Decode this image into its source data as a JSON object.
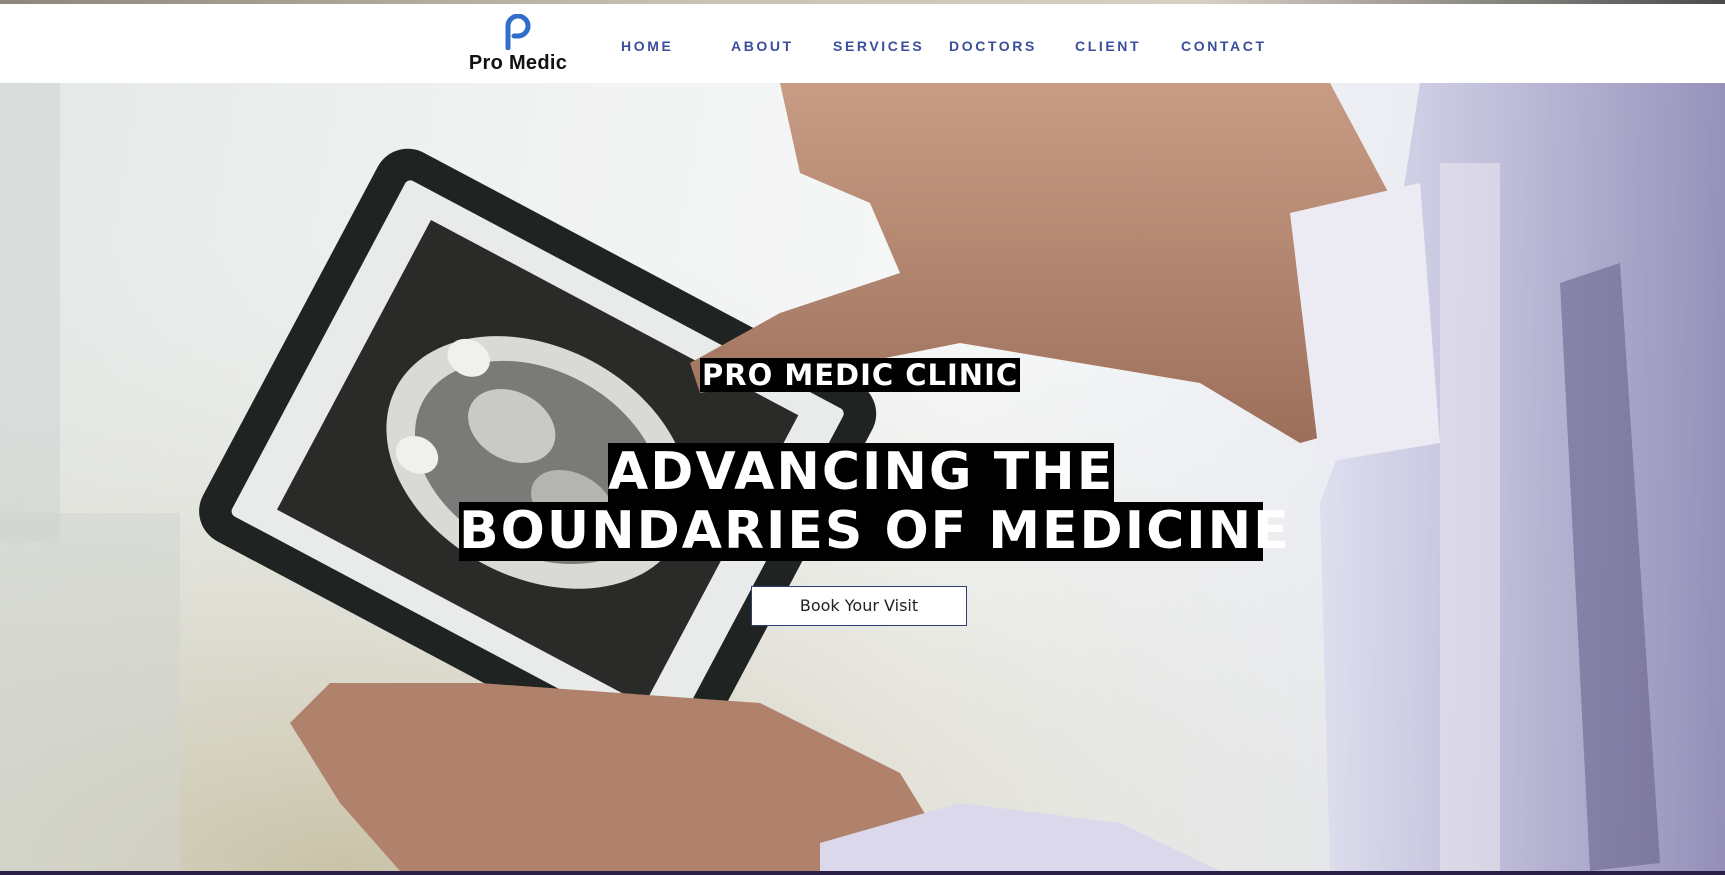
{
  "brand": {
    "name": "Pro Medic",
    "logo_icon": "p-letter-logo-icon",
    "accent_color": "#3a4e9c"
  },
  "nav": {
    "items": [
      {
        "label": "HOME"
      },
      {
        "label": "ABOUT"
      },
      {
        "label": "SERVICES"
      },
      {
        "label": "DOCTORS"
      },
      {
        "label": "CLIENT"
      },
      {
        "label": "CONTACT"
      }
    ]
  },
  "hero": {
    "eyebrow": "PRO MEDIC CLINIC",
    "headline_line1": "ADVANCING THE",
    "headline_line2": "BOUNDARIES OF MEDICINE",
    "cta_label": "Book Your Visit"
  }
}
